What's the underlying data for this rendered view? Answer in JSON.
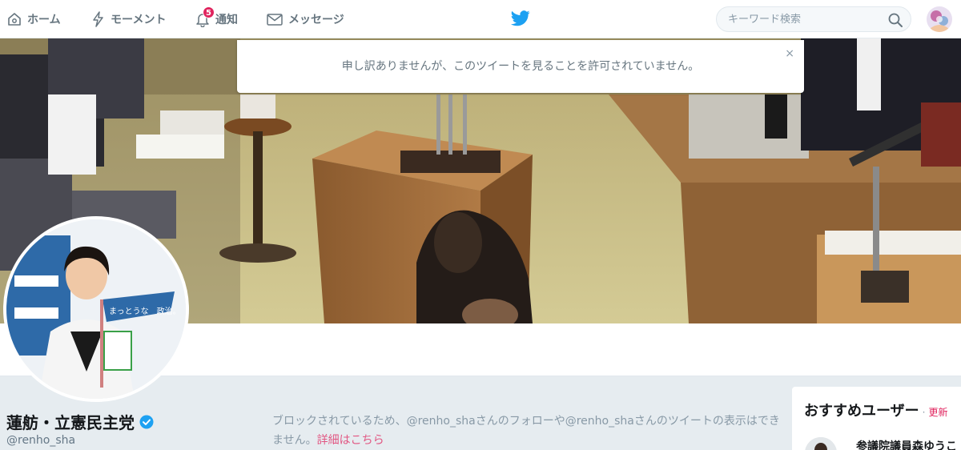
{
  "nav": {
    "home_label": "ホーム",
    "moments_label": "モーメント",
    "notifications_label": "通知",
    "notifications_count": "5",
    "messages_label": "メッセージ"
  },
  "search": {
    "placeholder": "キーワード検索"
  },
  "alert": {
    "message": "申し訳ありませんが、このツイートを見ることを許可されていません。",
    "close": "×"
  },
  "profile": {
    "name": "蓮舫・立憲民主党",
    "handle": "@renho_sha",
    "blocked_message": "ブロックされているため、@renho_shaさんのフォローや@renho_shaさんのツイートの表示はできません。",
    "details_link": "詳細はこちら",
    "avatar_flag_text": "まっとうな　政治。"
  },
  "suggestions": {
    "title": "おすすめユーザー",
    "separator": "·",
    "refresh": "更新",
    "items": [
      {
        "name": "参議院議員森ゆうこ"
      }
    ]
  },
  "colors": {
    "brand": "#1da1f2",
    "accent": "#e0245e",
    "muted": "#66757f"
  }
}
